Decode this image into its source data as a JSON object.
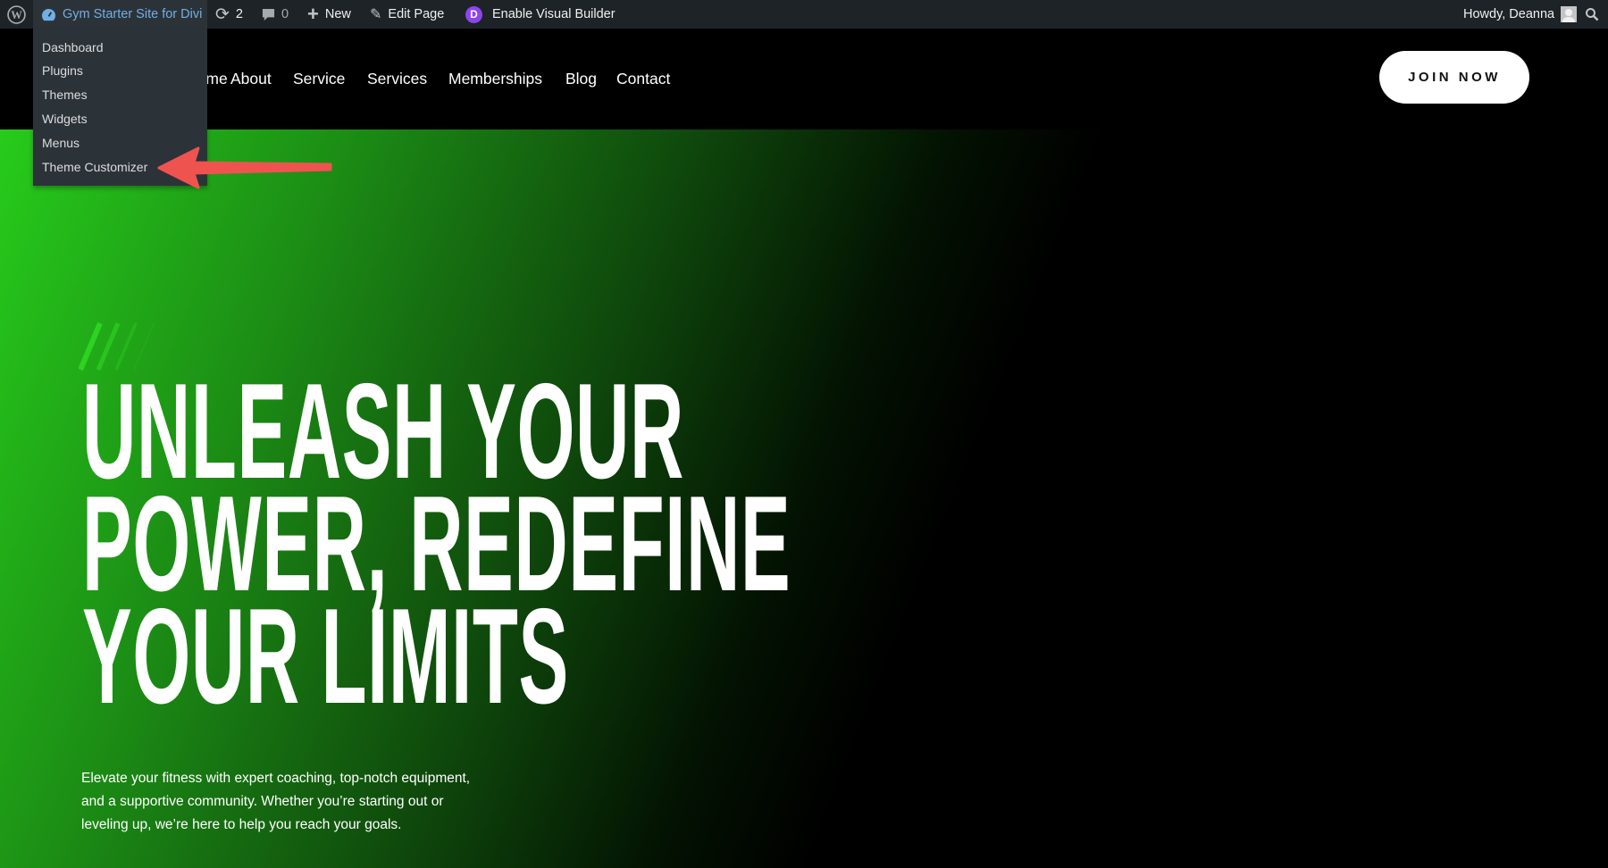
{
  "admin_bar": {
    "site_name": "Gym Starter Site for Divi",
    "updates_count": "2",
    "comments_count": "0",
    "new_label": "New",
    "edit_page_label": "Edit Page",
    "divi_letter": "D",
    "visual_builder_label": "Enable Visual Builder",
    "greeting": "Howdy, Deanna"
  },
  "site_menu": {
    "items": [
      "Dashboard",
      "Plugins",
      "Themes",
      "Widgets",
      "Menus",
      "Theme Customizer"
    ]
  },
  "nav": {
    "items": [
      "Home",
      "About",
      "Service",
      "Services",
      "Memberships",
      "Blog",
      "Contact"
    ],
    "cta": "JOIN NOW"
  },
  "hero": {
    "headline_lines": [
      "UNLEASH YOUR",
      "POWER, REDEFINE",
      "YOUR LIMITS"
    ],
    "paragraph_lines": [
      "Elevate your fitness with expert coaching, top-notch equipment,",
      "and a supportive community. Whether you’re starting out or",
      "leveling up, we’re here to help you reach your goals."
    ]
  },
  "colors": {
    "adminbar": "#1d2327",
    "submenu": "#2c3338",
    "accent_green": "#27cc1b",
    "link_blue": "#72aee6",
    "divi_purple": "#8e44ec",
    "annotation_arrow": "#ef5350"
  }
}
